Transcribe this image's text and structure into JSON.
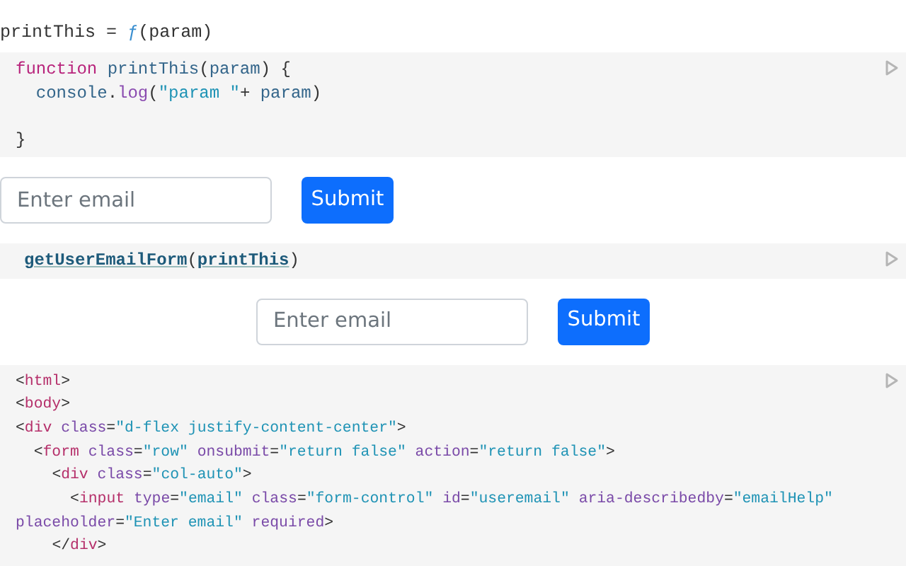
{
  "cells": [
    {
      "kind": "output",
      "text": "printThis = ƒ(param)"
    },
    {
      "kind": "js",
      "lines": [
        {
          "text": "function printThis(param) {"
        },
        {
          "text": "  console.log(\"param \"+ param)"
        },
        {
          "text": "}",
          "gap_before": true
        }
      ]
    },
    {
      "kind": "form",
      "centered": false,
      "placeholder": "Enter email",
      "button": "Submit"
    },
    {
      "kind": "call",
      "lines": [
        {
          "text": "**getUserEmailForm**(**printThis**)"
        }
      ]
    },
    {
      "kind": "form",
      "centered": true,
      "placeholder": "Enter email",
      "button": "Submit"
    },
    {
      "kind": "html",
      "lines": [
        {
          "text": "<html>"
        },
        {
          "text": "<body>"
        },
        {
          "text": "<div class=\"d-flex justify-content-center\">"
        },
        {
          "text": "  <form class=\"row\" onsubmit=\"return false\" action=\"return false\">"
        },
        {
          "text": "    <div class=\"col-auto\">"
        },
        {
          "text": "      <input type=\"email\" class=\"form-control\" id=\"useremail\" aria-describedby=\"emailHelp\""
        },
        {
          "text": "placeholder=\"Enter email\" required>"
        },
        {
          "text": "    </div>"
        }
      ]
    }
  ]
}
